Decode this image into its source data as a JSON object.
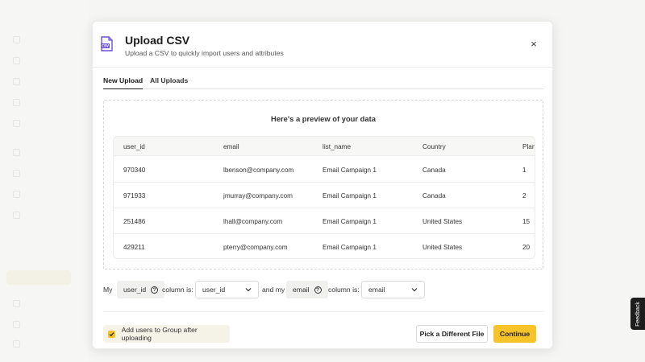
{
  "modal": {
    "title": "Upload CSV",
    "subtitle": "Upload a CSV to quickly import users and attributes",
    "close_icon": "×"
  },
  "tabs": [
    {
      "label": "New Upload",
      "active": true
    },
    {
      "label": "All Uploads",
      "active": false
    }
  ],
  "preview": {
    "title": "Here's a preview of your data",
    "columns": [
      "user_id",
      "email",
      "list_name",
      "Country",
      "Plan"
    ],
    "rows": [
      [
        "970340",
        "lbenson@company.com",
        "Email Campaign 1",
        "Canada",
        "1"
      ],
      [
        "971933",
        "jmurray@company.com",
        "Email Campaign 1",
        "Canada",
        "2"
      ],
      [
        "251486",
        "lhall@company.com",
        "Email Campaign 1",
        "United States",
        "15"
      ],
      [
        "429211",
        "pterry@company.com",
        "Email Campaign 1",
        "United States",
        "20"
      ]
    ]
  },
  "mapping": {
    "my_label": "My",
    "user_id_chip": "user_id",
    "column_is_1": "column is:",
    "user_id_select": "user_id",
    "and_my": "and my",
    "email_chip": "email",
    "column_is_2": "column is:",
    "email_select": "email"
  },
  "footer": {
    "checkbox_label": "Add users to Group after uploading",
    "checkbox_checked": true,
    "secondary_button": "Pick a Different File",
    "primary_button": "Continue"
  },
  "feedback_tab": "Feedback",
  "colors": {
    "accent": "#f6c429",
    "icon_purple": "#6b4fd8"
  }
}
